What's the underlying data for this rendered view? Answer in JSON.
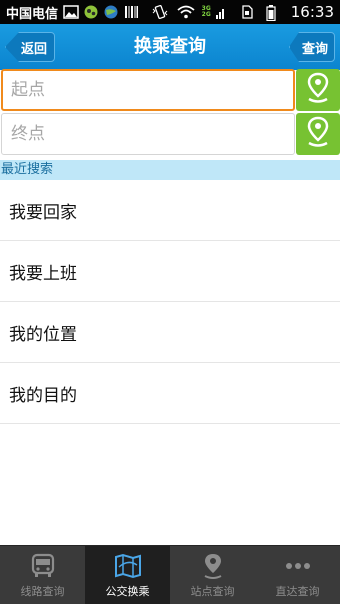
{
  "status_bar": {
    "carrier": "中国电信",
    "network_top": "3G",
    "network_bottom": "2G",
    "time": "16:33"
  },
  "header": {
    "title": "换乘查询",
    "back_label": "返回",
    "query_label": "查询"
  },
  "form": {
    "start_placeholder": "起点",
    "end_placeholder": "终点"
  },
  "recent": {
    "header": "最近搜索",
    "items": [
      {
        "label": "我要回家"
      },
      {
        "label": "我要上班"
      },
      {
        "label": "我的位置"
      },
      {
        "label": "我的目的"
      }
    ]
  },
  "tabs": [
    {
      "label": "线路查询",
      "icon": "bus-icon",
      "active": false
    },
    {
      "label": "公交换乘",
      "icon": "map-icon",
      "active": true
    },
    {
      "label": "站点查询",
      "icon": "location-pin-icon",
      "active": false
    },
    {
      "label": "直达查询",
      "icon": "more-dots-icon",
      "active": false
    }
  ],
  "colors": {
    "header_blue": "#0b84cf",
    "accent_green": "#77c232",
    "focus_orange": "#f08a1c",
    "recent_header_bg": "#bfe7f8"
  }
}
